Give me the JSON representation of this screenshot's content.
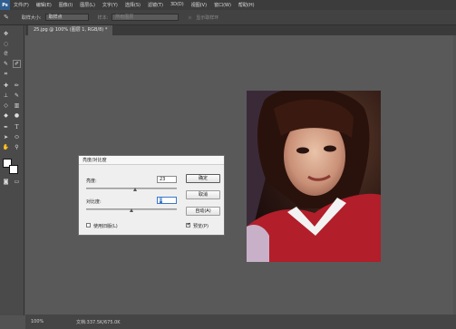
{
  "app": {
    "logo": "Ps"
  },
  "menu": [
    "文件(F)",
    "编辑(E)",
    "图像(I)",
    "图层(L)",
    "文字(Y)",
    "选择(S)",
    "滤镜(T)",
    "3D(D)",
    "视图(V)",
    "窗口(W)",
    "帮助(H)"
  ],
  "options": {
    "sample_size_label": "取样大小:",
    "sample_size_value": "取样点",
    "sample_label": "样本:",
    "sample_value": "所有图层",
    "show_ring": "显示取样环"
  },
  "document": {
    "tab_title": "25.jpg @ 100% (图层 1, RGB/8) *"
  },
  "status": {
    "zoom": "100%",
    "doc_size": "文档:337.5K/675.0K"
  },
  "dialog": {
    "title": "亮度/对比度",
    "brightness_label": "亮度:",
    "brightness_value": "23",
    "contrast_label": "对比度:",
    "contrast_value": "8",
    "brightness_fraction": 0.54,
    "contrast_fraction": 0.5,
    "ok": "确定",
    "cancel": "取消",
    "auto": "自动(A)",
    "use_legacy": "使用旧版(L)",
    "use_legacy_checked": false,
    "preview": "预览(P)",
    "preview_checked": true
  },
  "colors": {
    "foreground": "#ffffff",
    "background": "#ffffff",
    "focus": "#3a78c9"
  }
}
